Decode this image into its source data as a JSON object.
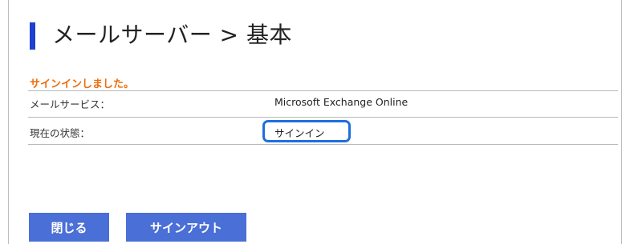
{
  "header": {
    "title": "メールサーバー > 基本"
  },
  "status": {
    "message": "サインインしました。"
  },
  "rows": [
    {
      "label": "メールサービス：",
      "value": "Microsoft Exchange Online"
    },
    {
      "label": "現在の状態：",
      "value": "サインイン"
    }
  ],
  "buttons": {
    "close_label": "閉じる",
    "signout_label": "サインアウト"
  },
  "colors": {
    "accent": "#1e3fd0",
    "status": "#ee6c0a",
    "button": "#4a6fd6",
    "highlight": "#1f6fdb"
  }
}
